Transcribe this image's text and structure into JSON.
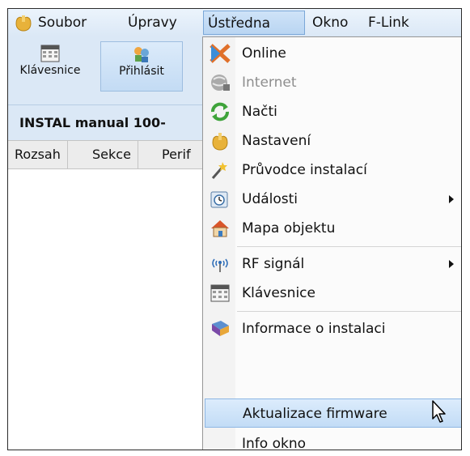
{
  "menubar": {
    "items": [
      {
        "label": "Soubor"
      },
      {
        "label": "Úpravy"
      },
      {
        "label": "Ústředna"
      },
      {
        "label": "Okno"
      },
      {
        "label": "F-Link"
      }
    ]
  },
  "toolbar": {
    "keyboard_label": "Klávesnice",
    "login_label": "Přihlásit"
  },
  "title": "INSTAL manual 100-",
  "tabs": [
    "Rozsah",
    "Sekce",
    "Perif"
  ],
  "dropdown": {
    "items": [
      {
        "label": "Online",
        "icon": "online-icon"
      },
      {
        "label": "Internet",
        "icon": "internet-icon",
        "disabled": true
      },
      {
        "label": "Načti",
        "icon": "refresh-icon"
      },
      {
        "label": "Nastavení",
        "icon": "settings-icon"
      },
      {
        "label": "Průvodce instalací",
        "icon": "wizard-icon"
      },
      {
        "label": "Události",
        "icon": "events-icon",
        "submenu": true
      },
      {
        "label": "Mapa objektu",
        "icon": "house-icon"
      },
      {
        "label": "RF signál",
        "icon": "rf-signal-icon",
        "submenu": true
      },
      {
        "label": "Klávesnice",
        "icon": "keyboard-icon"
      },
      {
        "label": "Informace o instalaci",
        "icon": "info-book-icon"
      },
      {
        "label": "Aktualizace firmware",
        "icon": "",
        "highlighted": true
      },
      {
        "label": "Info okno",
        "icon": ""
      }
    ]
  },
  "colors": {
    "menubar_bg": "#dbe8f6",
    "highlight": "#c2dcf6",
    "disabled_text": "#8e8e8e"
  }
}
